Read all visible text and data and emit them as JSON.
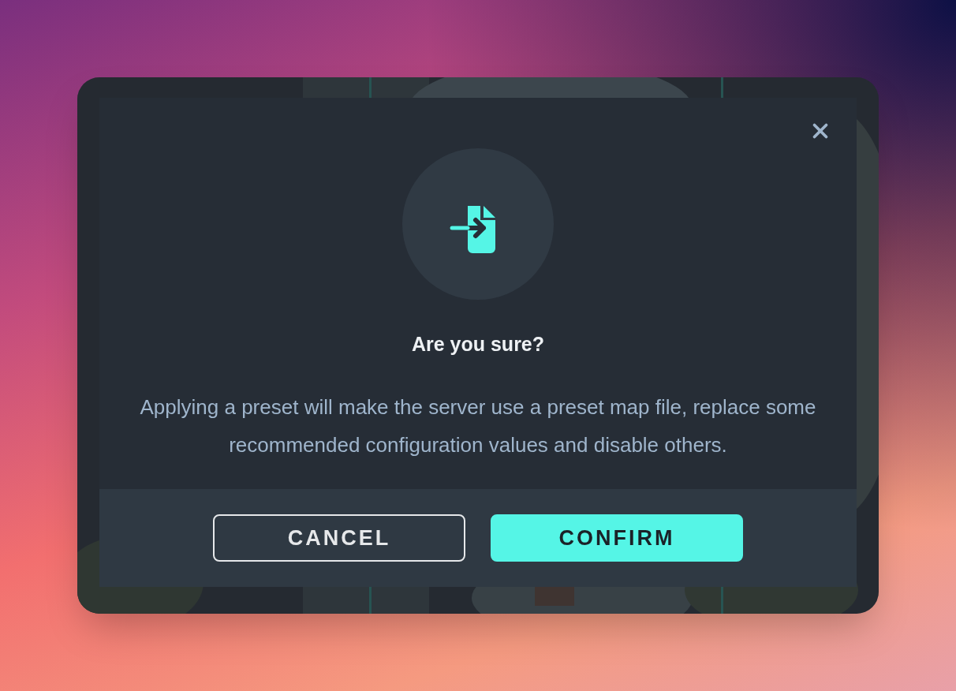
{
  "dialog": {
    "title": "Are you sure?",
    "message": "Applying a preset will make the server use a preset map file, replace some recommended configuration values and disable others.",
    "buttons": [
      {
        "label": "CANCEL",
        "kind": "secondary"
      },
      {
        "label": "CONFIRM",
        "kind": "primary"
      }
    ]
  }
}
